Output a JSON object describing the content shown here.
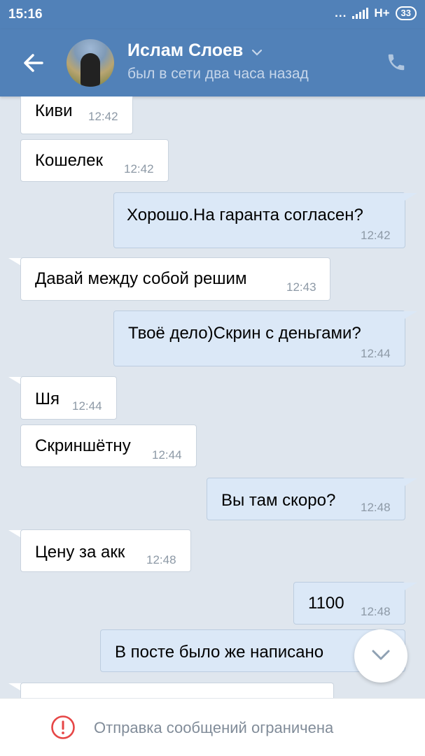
{
  "status_bar": {
    "time": "15:16",
    "dots": "...",
    "network": "H+",
    "battery": "33"
  },
  "header": {
    "contact_name": "Ислам Слоев",
    "contact_status": "был в сети два часа назад",
    "accent_color": "#5181b8"
  },
  "messages": [
    {
      "side": "in",
      "text": "Киви",
      "time": "12:42"
    },
    {
      "side": "in",
      "text": "Кошелек",
      "time": "12:42"
    },
    {
      "side": "out",
      "text": "Хорошо.На гаранта согласен?",
      "time": "12:42"
    },
    {
      "side": "in",
      "text": "Давай между собой решим",
      "time": "12:43"
    },
    {
      "side": "out",
      "text": "Твоё дело)Скрин с деньгами?",
      "time": "12:44"
    },
    {
      "side": "in",
      "text": "Шя",
      "time": "12:44"
    },
    {
      "side": "in",
      "text": "Скриншётну",
      "time": "12:44"
    },
    {
      "side": "out",
      "text": "Вы там скоро?",
      "time": "12:48"
    },
    {
      "side": "in",
      "text": "Цену за акк",
      "time": "12:48"
    },
    {
      "side": "out",
      "text": "1100",
      "time": "12:48"
    },
    {
      "side": "out",
      "text": "В посте было же написано",
      "time": ""
    }
  ],
  "footer": {
    "notice": "Отправка сообщений ограничена"
  }
}
